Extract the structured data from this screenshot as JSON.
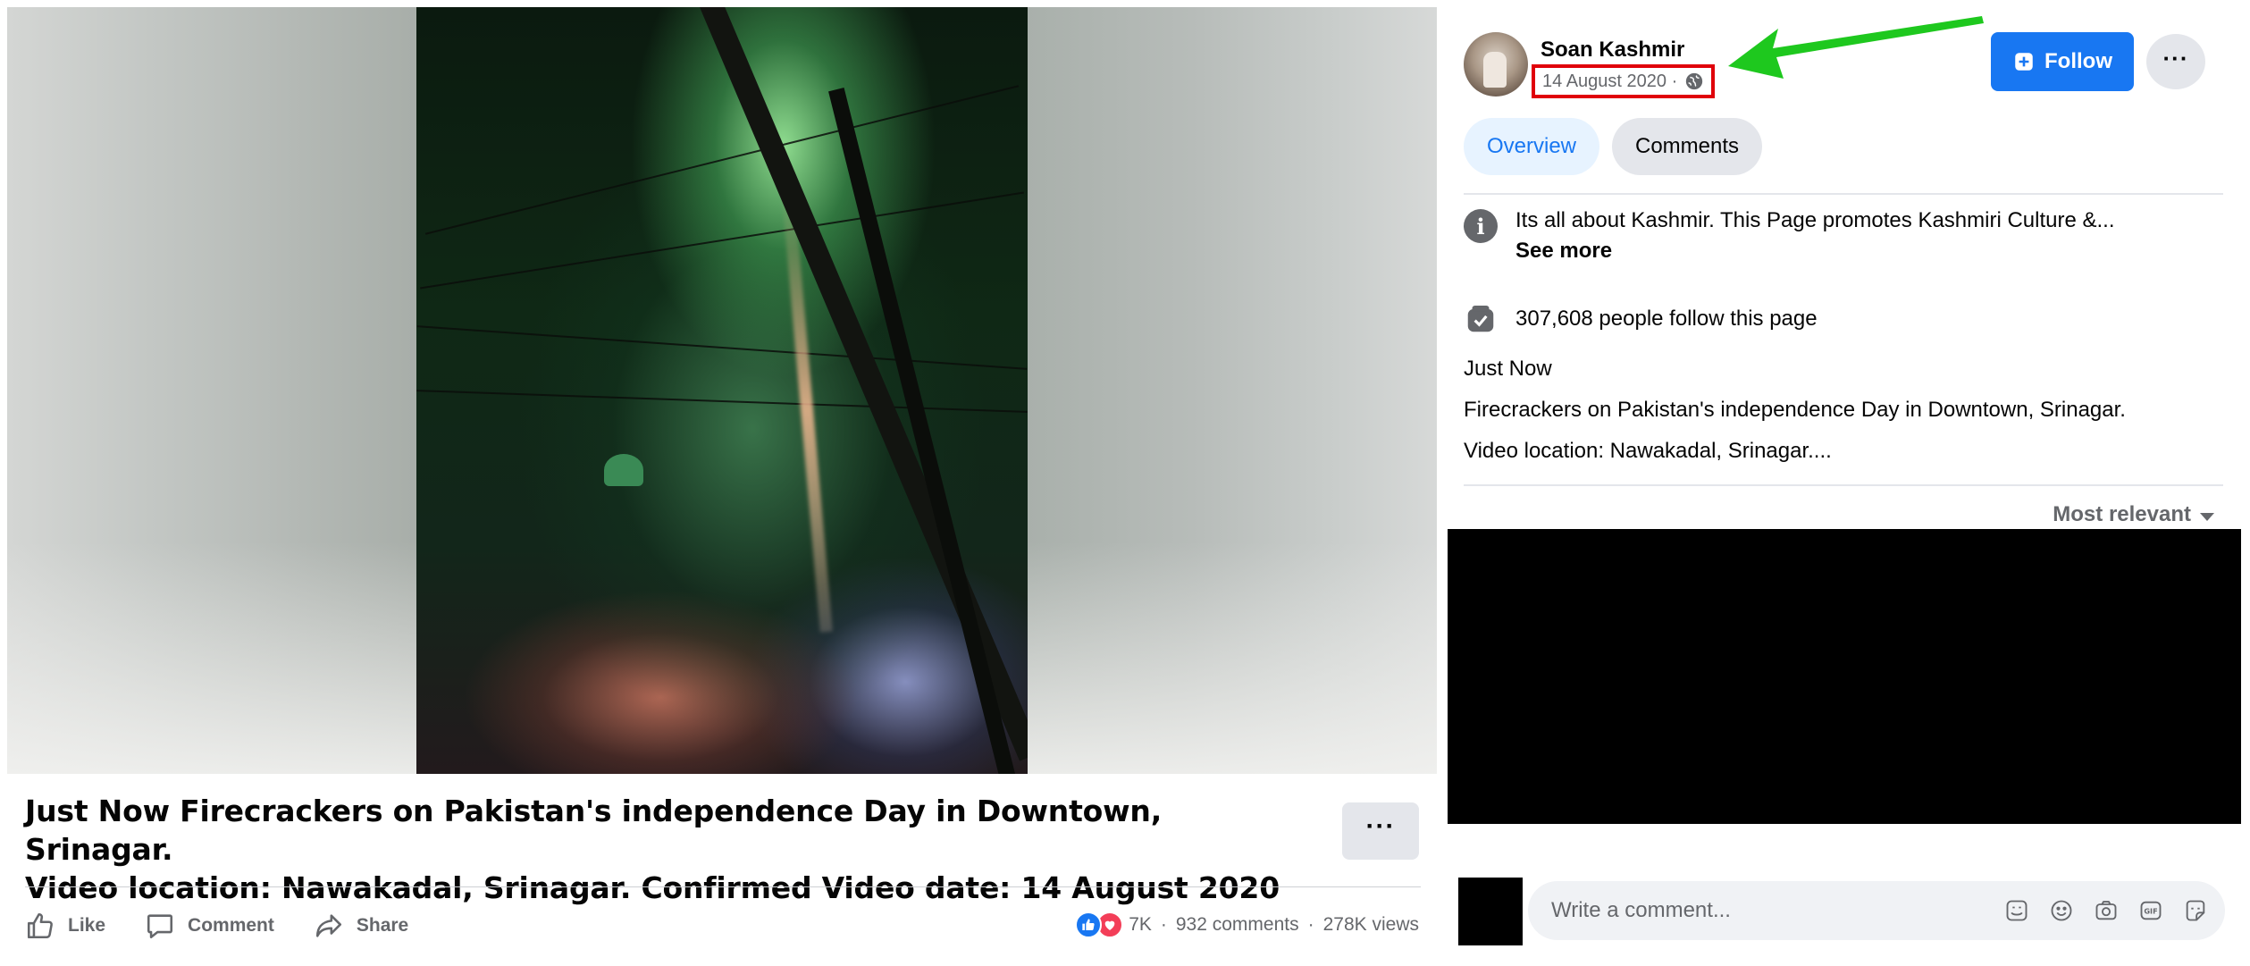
{
  "video": {
    "description_label": "video-player"
  },
  "caption": {
    "line1": "Just Now Firecrackers on Pakistan's independence Day in Downtown, Srinagar.",
    "line2": "Video location: Nawakadal, Srinagar. Confirmed Video date: 14 August 2020",
    "more_label": "···"
  },
  "actions": {
    "like": "Like",
    "comment": "Comment",
    "share": "Share"
  },
  "stats": {
    "reactions_count": "7K",
    "comments": "932 comments",
    "views": "278K views",
    "separator": "·"
  },
  "page": {
    "name": "Soan Kashmir",
    "post_date": "14 August 2020 ·",
    "follow_label": "Follow",
    "more_label": "···"
  },
  "tabs": [
    {
      "label": "Overview"
    },
    {
      "label": "Comments"
    }
  ],
  "about": {
    "text": "Its all about Kashmir. This Page promotes Kashmiri Culture &...",
    "see_more": "See more",
    "followers": "307,608 people follow this page"
  },
  "description": {
    "line1": "Just Now",
    "line2": "Firecrackers on Pakistan's independence Day in Downtown, Srinagar.",
    "line3": "Video location: Nawakadal, Srinagar...."
  },
  "comments": {
    "sort_label": "Most relevant",
    "placeholder": "Write a comment..."
  },
  "colors": {
    "brand_blue": "#1877f2",
    "highlight_red": "#e0000a",
    "arrow_green": "#1ec81e",
    "love_red": "#f33e58"
  },
  "icons": [
    "like-icon",
    "comment-icon",
    "share-icon",
    "globe-icon",
    "info-icon",
    "follow-page-icon",
    "sticker-icon",
    "emoji-icon",
    "camera-icon",
    "gif-icon",
    "avatar-sticker-icon"
  ]
}
